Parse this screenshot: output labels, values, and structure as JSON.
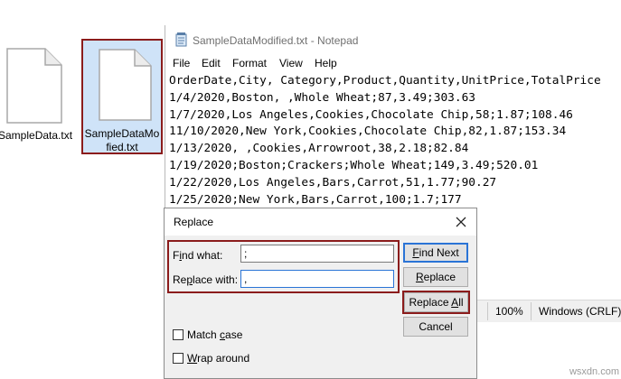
{
  "explorer": {
    "files": [
      {
        "name": "SampleData.txt"
      },
      {
        "name_line1": "SampleDataMo",
        "name_line2": "fied.txt"
      }
    ]
  },
  "notepad": {
    "title": "SampleDataModified.txt - Notepad",
    "menu": [
      "File",
      "Edit",
      "Format",
      "View",
      "Help"
    ],
    "lines": [
      "OrderDate,City, Category,Product,Quantity,UnitPrice,TotalPrice",
      "1/4/2020,Boston, ,Whole Wheat;87,3.49;303.63",
      "1/7/2020,Los Angeles,Cookies,Chocolate Chip,58;1.87;108.46",
      "11/10/2020,New York,Cookies,Chocolate Chip,82,1.87;153.34",
      "1/13/2020, ,Cookies,Arrowroot,38,2.18;82.84",
      "1/19/2020;Boston;Crackers;Whole Wheat;149,3.49;520.01",
      "1/22/2020,Los Angeles,Bars,Carrot,51,1.77;90.27",
      "1/25/2020;New York,Bars,Carrot,100;1.7;177"
    ],
    "status": {
      "zoom": "100%",
      "line_ending": "Windows (CRLF)"
    }
  },
  "replace_dialog": {
    "title": "Replace",
    "find_label": {
      "pre": "F",
      "u": "i",
      "post": "nd what:"
    },
    "find_value": ";",
    "replace_label": {
      "pre": "Re",
      "u": "p",
      "post": "lace with:"
    },
    "replace_value": ",",
    "buttons": {
      "find_next": {
        "pre": "",
        "u": "F",
        "post": "ind Next"
      },
      "replace": {
        "pre": "",
        "u": "R",
        "post": "eplace"
      },
      "replace_all": {
        "pre": "Replace ",
        "u": "A",
        "post": "ll"
      },
      "cancel": "Cancel"
    },
    "match_case": {
      "pre": "Match ",
      "u": "c",
      "post": "ase"
    },
    "wrap_around": {
      "pre": "",
      "u": "W",
      "post": "rap around"
    }
  },
  "watermark": "wsxdn.com"
}
